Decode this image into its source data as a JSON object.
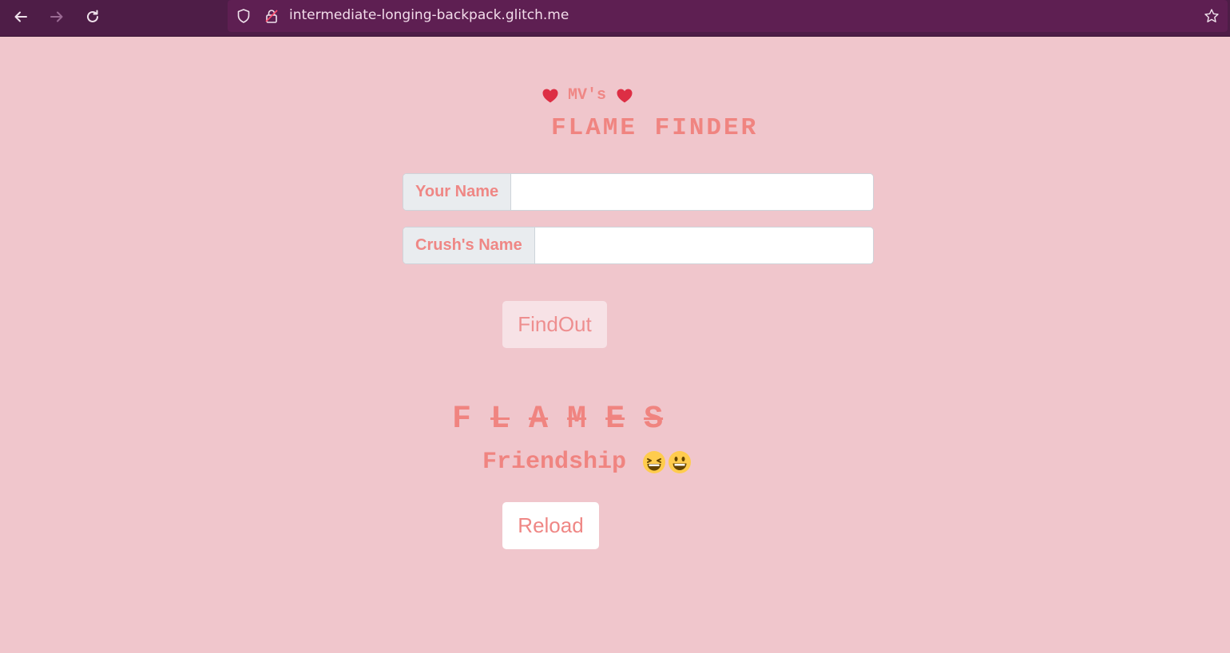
{
  "browser": {
    "url": "intermediate-longing-backpack.glitch.me",
    "back_icon": "arrow-left-icon",
    "forward_icon": "arrow-right-icon",
    "reload_icon": "reload-icon",
    "shield_icon": "shield-icon",
    "lock_icon": "lock-icon",
    "bookmark_icon": "star-icon"
  },
  "page": {
    "brand": "MV's",
    "title": "FLAME FINDER",
    "your_name_label": "Your Name",
    "your_name_value": "",
    "crush_name_label": "Crush's Name",
    "crush_name_value": "",
    "find_button": "FindOut",
    "flames_letters": [
      "F",
      "L",
      "A",
      "M",
      "E",
      "S"
    ],
    "result_text": "Friendship",
    "reload_button": "Reload"
  },
  "colors": {
    "background": "#f0c6cc",
    "accent": "#f08480",
    "toolbar": "#4e1d47",
    "heart": "#dd2e44"
  }
}
